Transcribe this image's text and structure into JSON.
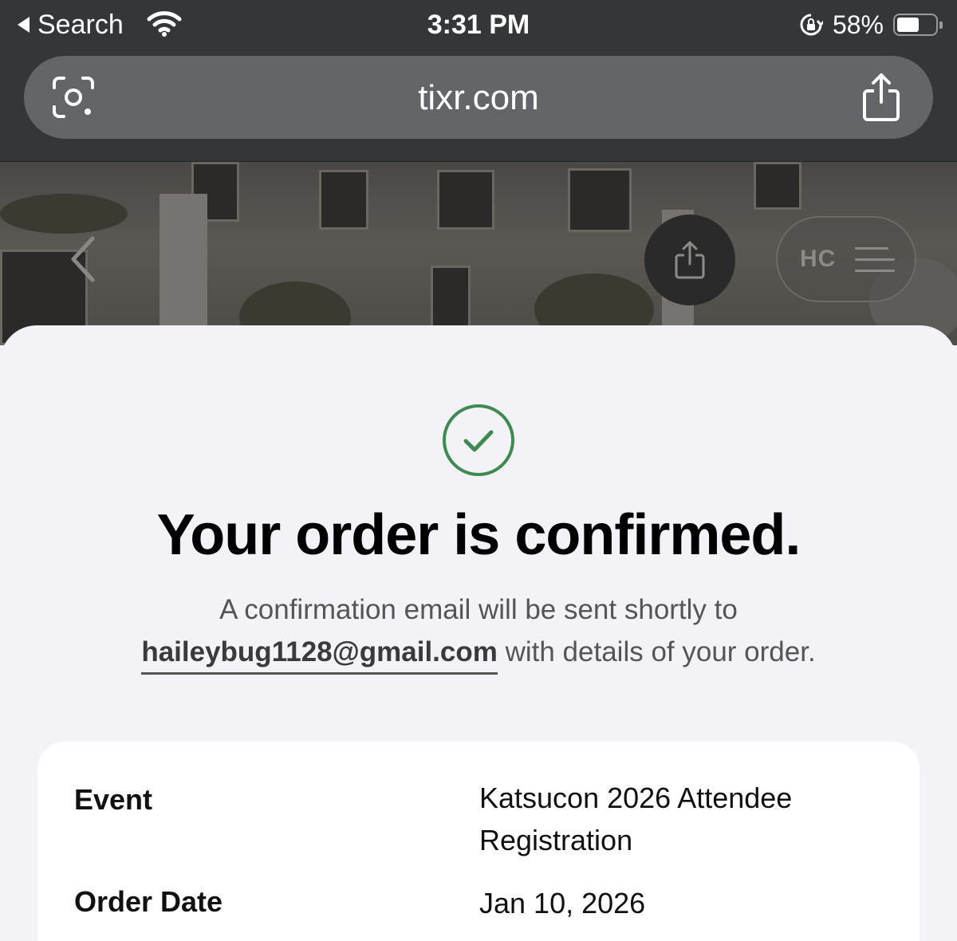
{
  "status_bar": {
    "back_label": "Search",
    "time": "3:31 PM",
    "battery_percent": "58%",
    "battery_level": 0.58
  },
  "browser": {
    "url": "tixr.com"
  },
  "hero": {
    "menu_initials": "HC"
  },
  "confirmation": {
    "title": "Your order is confirmed.",
    "message_line1": "A confirmation email will be sent shortly to",
    "email": "haileybug1128@gmail.com",
    "message_suffix": " with details of your order.",
    "accent_color": "#3d8b4f"
  },
  "order_details": [
    {
      "label": "Event",
      "value": "Katsucon 2026 Attendee Registration"
    },
    {
      "label": "Order Date",
      "value": "Jan 10, 2026"
    }
  ]
}
